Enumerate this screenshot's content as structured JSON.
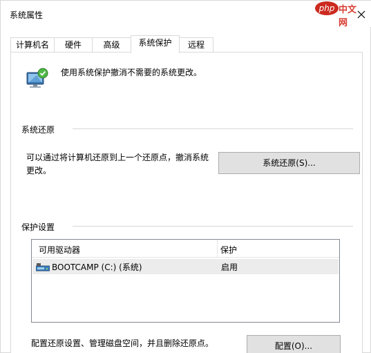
{
  "window": {
    "title": "系统属性"
  },
  "watermark": {
    "logo": "php",
    "text": "中文网"
  },
  "tabs": [
    {
      "label": "计算机名"
    },
    {
      "label": "硬件"
    },
    {
      "label": "高级"
    },
    {
      "label": "系统保护"
    },
    {
      "label": "远程"
    }
  ],
  "active_tab": "系统保护",
  "header": {
    "description": "使用系统保护撤消不需要的系统更改。"
  },
  "system_restore": {
    "section_label": "系统还原",
    "text": "可以通过将计算机还原到上一个还原点，撤消系统更改。",
    "button_label": "系统还原(S)..."
  },
  "protection": {
    "section_label": "保护设置",
    "columns": [
      "可用驱动器",
      "保护"
    ],
    "drives": [
      {
        "name": "BOOTCAMP (C:) (系统)",
        "status": "启用",
        "icon": "drive-icon"
      }
    ],
    "config_text": "配置还原设置、管理磁盘空间，并且删除还原点。",
    "config_button_label": "配置(O)..."
  },
  "icons": {
    "close": "close-icon",
    "system_protection": "system-protection-icon"
  }
}
